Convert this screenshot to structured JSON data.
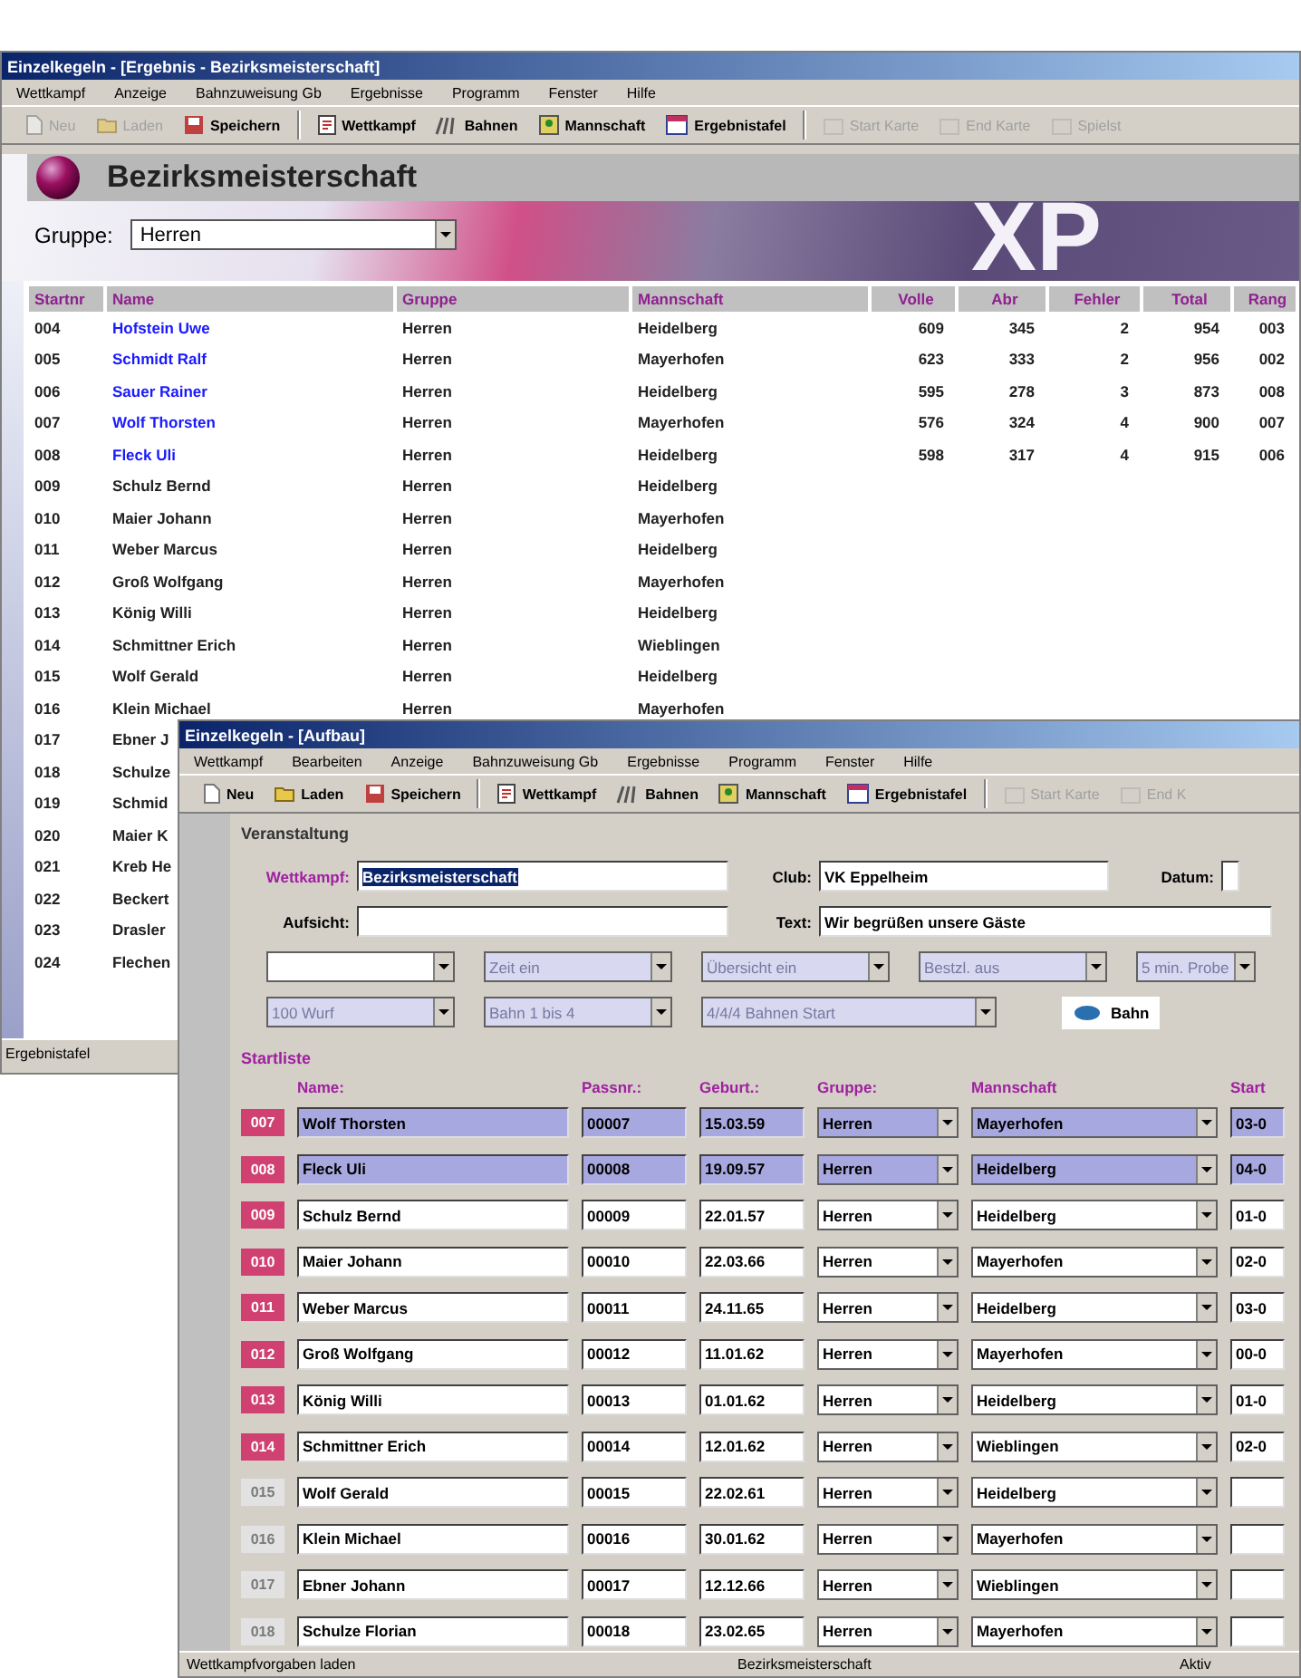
{
  "back_window": {
    "title": "Einzelkegeln - [Ergebnis - Bezirksmeisterschaft]",
    "menu": [
      "Wettkampf",
      "Anzeige",
      "Bahnzuweisung Gb",
      "Ergebnisse",
      "Programm",
      "Fenster",
      "Hilfe"
    ],
    "toolbar": [
      {
        "label": "Neu",
        "disabled": true
      },
      {
        "label": "Laden",
        "disabled": true
      },
      {
        "label": "Speichern",
        "disabled": false
      },
      {
        "label": "Wettkampf",
        "disabled": false
      },
      {
        "label": "Bahnen",
        "disabled": false
      },
      {
        "label": "Mannschaft",
        "disabled": false
      },
      {
        "label": "Ergebnistafel",
        "disabled": false
      },
      {
        "label": "Start Karte",
        "disabled": true
      },
      {
        "label": "End Karte",
        "disabled": true
      },
      {
        "label": "Spielst",
        "disabled": true
      }
    ],
    "header": "Bezirksmeisterschaft",
    "banner_text": "XP",
    "group_filter": {
      "label": "Gruppe:",
      "value": "Herren"
    },
    "table": {
      "columns": [
        "Startnr",
        "Name",
        "Gruppe",
        "Mannschaft",
        "Volle",
        "Abr",
        "Fehler",
        "Total",
        "Rang"
      ],
      "rows": [
        {
          "startnr": "004",
          "name": "Hofstein Uwe",
          "gruppe": "Herren",
          "mannschaft": "Heidelberg",
          "volle": "609",
          "abr": "345",
          "fehler": "2",
          "total": "954",
          "rang": "003",
          "played": true
        },
        {
          "startnr": "005",
          "name": "Schmidt Ralf",
          "gruppe": "Herren",
          "mannschaft": "Mayerhofen",
          "volle": "623",
          "abr": "333",
          "fehler": "2",
          "total": "956",
          "rang": "002",
          "played": true
        },
        {
          "startnr": "006",
          "name": "Sauer Rainer",
          "gruppe": "Herren",
          "mannschaft": "Heidelberg",
          "volle": "595",
          "abr": "278",
          "fehler": "3",
          "total": "873",
          "rang": "008",
          "played": true
        },
        {
          "startnr": "007",
          "name": "Wolf Thorsten",
          "gruppe": "Herren",
          "mannschaft": "Mayerhofen",
          "volle": "576",
          "abr": "324",
          "fehler": "4",
          "total": "900",
          "rang": "007",
          "played": true
        },
        {
          "startnr": "008",
          "name": "Fleck Uli",
          "gruppe": "Herren",
          "mannschaft": "Heidelberg",
          "volle": "598",
          "abr": "317",
          "fehler": "4",
          "total": "915",
          "rang": "006",
          "played": true
        },
        {
          "startnr": "009",
          "name": "Schulz Bernd",
          "gruppe": "Herren",
          "mannschaft": "Heidelberg",
          "played": false
        },
        {
          "startnr": "010",
          "name": "Maier Johann",
          "gruppe": "Herren",
          "mannschaft": "Mayerhofen",
          "played": false
        },
        {
          "startnr": "011",
          "name": "Weber Marcus",
          "gruppe": "Herren",
          "mannschaft": "Heidelberg",
          "played": false
        },
        {
          "startnr": "012",
          "name": "Groß Wolfgang",
          "gruppe": "Herren",
          "mannschaft": "Mayerhofen",
          "played": false
        },
        {
          "startnr": "013",
          "name": "König Willi",
          "gruppe": "Herren",
          "mannschaft": "Heidelberg",
          "played": false
        },
        {
          "startnr": "014",
          "name": "Schmittner Erich",
          "gruppe": "Herren",
          "mannschaft": "Wieblingen",
          "played": false
        },
        {
          "startnr": "015",
          "name": "Wolf Gerald",
          "gruppe": "Herren",
          "mannschaft": "Heidelberg",
          "played": false
        },
        {
          "startnr": "016",
          "name": "Klein Michael",
          "gruppe": "Herren",
          "mannschaft": "Mayerhofen",
          "played": false
        },
        {
          "startnr": "017",
          "name": "Ebner J",
          "played": false
        },
        {
          "startnr": "018",
          "name": "Schulze",
          "played": false
        },
        {
          "startnr": "019",
          "name": "Schmid",
          "played": false
        },
        {
          "startnr": "020",
          "name": "Maier K",
          "played": false
        },
        {
          "startnr": "021",
          "name": "Kreb He",
          "played": false
        },
        {
          "startnr": "022",
          "name": "Beckert",
          "played": false
        },
        {
          "startnr": "023",
          "name": "Drasler",
          "played": false
        },
        {
          "startnr": "024",
          "name": "Flechen",
          "played": false
        }
      ]
    },
    "status_bar": "Ergebnistafel"
  },
  "front_window": {
    "title": "Einzelkegeln - [Aufbau]",
    "menu": [
      "Wettkampf",
      "Bearbeiten",
      "Anzeige",
      "Bahnzuweisung Gb",
      "Ergebnisse",
      "Programm",
      "Fenster",
      "Hilfe"
    ],
    "toolbar": [
      {
        "label": "Neu",
        "disabled": false
      },
      {
        "label": "Laden",
        "disabled": false
      },
      {
        "label": "Speichern",
        "disabled": false
      },
      {
        "label": "Wettkampf",
        "disabled": false
      },
      {
        "label": "Bahnen",
        "disabled": false
      },
      {
        "label": "Mannschaft",
        "disabled": false
      },
      {
        "label": "Ergebnistafel",
        "disabled": false
      },
      {
        "label": "Start Karte",
        "disabled": true
      },
      {
        "label": "End K",
        "disabled": true
      }
    ],
    "event": {
      "title": "Veranstaltung",
      "fields": [
        {
          "label": "Wettkampf:",
          "value": "Bezirksmeisterschaft",
          "highlighted": true
        },
        {
          "label": "Club:",
          "value": "VK Eppelheim",
          "highlighted": false
        },
        {
          "label": "Datum:"
        },
        {
          "label": "Aufsicht:"
        },
        {
          "label": "Text:",
          "value": "Wir begrüßen unsere Gäste",
          "highlighted": false
        }
      ],
      "dropdowns": [
        {
          "disabled": false
        },
        {
          "value": "Zeit ein",
          "disabled": true
        },
        {
          "value": "Übersicht ein",
          "disabled": true
        },
        {
          "value": "Bestzl. aus",
          "disabled": true
        },
        {
          "value": "5 min. Probe",
          "disabled": true
        },
        {
          "value": "100 Wurf",
          "disabled": true
        },
        {
          "value": "Bahn 1 bis 4",
          "disabled": true
        },
        {
          "value": "4/4/4 Bahnen Start",
          "disabled": true
        }
      ],
      "button": "Bahn"
    },
    "start_list": {
      "title": "Startliste",
      "columns": [
        "Name:",
        "Passnr.:",
        "Geburt.:",
        "Gruppe:",
        "Mannschaft",
        "Start"
      ],
      "rows": [
        {
          "nr": "007",
          "name": "Wolf Thorsten",
          "pass": "00007",
          "born": "15.03.59",
          "gruppe": "Herren",
          "mannschaft": "Mayerhofen",
          "start": "03-0",
          "selected": true,
          "assigned": true
        },
        {
          "nr": "008",
          "name": "Fleck Uli",
          "pass": "00008",
          "born": "19.09.57",
          "gruppe": "Herren",
          "mannschaft": "Heidelberg",
          "start": "04-0",
          "selected": true,
          "assigned": true
        },
        {
          "nr": "009",
          "name": "Schulz Bernd",
          "pass": "00009",
          "born": "22.01.57",
          "gruppe": "Herren",
          "mannschaft": "Heidelberg",
          "start": "01-0",
          "selected": false,
          "assigned": true
        },
        {
          "nr": "010",
          "name": "Maier Johann",
          "pass": "00010",
          "born": "22.03.66",
          "gruppe": "Herren",
          "mannschaft": "Mayerhofen",
          "start": "02-0",
          "selected": false,
          "assigned": true
        },
        {
          "nr": "011",
          "name": "Weber Marcus",
          "pass": "00011",
          "born": "24.11.65",
          "gruppe": "Herren",
          "mannschaft": "Heidelberg",
          "start": "03-0",
          "selected": false,
          "assigned": true
        },
        {
          "nr": "012",
          "name": "Groß Wolfgang",
          "pass": "00012",
          "born": "11.01.62",
          "gruppe": "Herren",
          "mannschaft": "Mayerhofen",
          "start": "00-0",
          "selected": false,
          "assigned": true
        },
        {
          "nr": "013",
          "name": "König Willi",
          "pass": "00013",
          "born": "01.01.62",
          "gruppe": "Herren",
          "mannschaft": "Heidelberg",
          "start": "01-0",
          "selected": false,
          "assigned": true
        },
        {
          "nr": "014",
          "name": "Schmittner Erich",
          "pass": "00014",
          "born": "12.01.62",
          "gruppe": "Herren",
          "mannschaft": "Wieblingen",
          "start": "02-0",
          "selected": false,
          "assigned": true
        },
        {
          "nr": "015",
          "name": "Wolf Gerald",
          "pass": "00015",
          "born": "22.02.61",
          "gruppe": "Herren",
          "mannschaft": "Heidelberg",
          "selected": false,
          "assigned": false
        },
        {
          "nr": "016",
          "name": "Klein Michael",
          "pass": "00016",
          "born": "30.01.62",
          "gruppe": "Herren",
          "mannschaft": "Mayerhofen",
          "selected": false,
          "assigned": false
        },
        {
          "nr": "017",
          "name": "Ebner Johann",
          "pass": "00017",
          "born": "12.12.66",
          "gruppe": "Herren",
          "mannschaft": "Wieblingen",
          "selected": false,
          "assigned": false
        },
        {
          "nr": "018",
          "name": "Schulze Florian",
          "pass": "00018",
          "born": "23.02.65",
          "gruppe": "Herren",
          "mannschaft": "Mayerhofen",
          "selected": false,
          "assigned": false
        }
      ]
    },
    "status_bar": [
      "Wettkampfvorgaben laden",
      "Bezirksmeisterschaft",
      "Aktiv"
    ]
  }
}
